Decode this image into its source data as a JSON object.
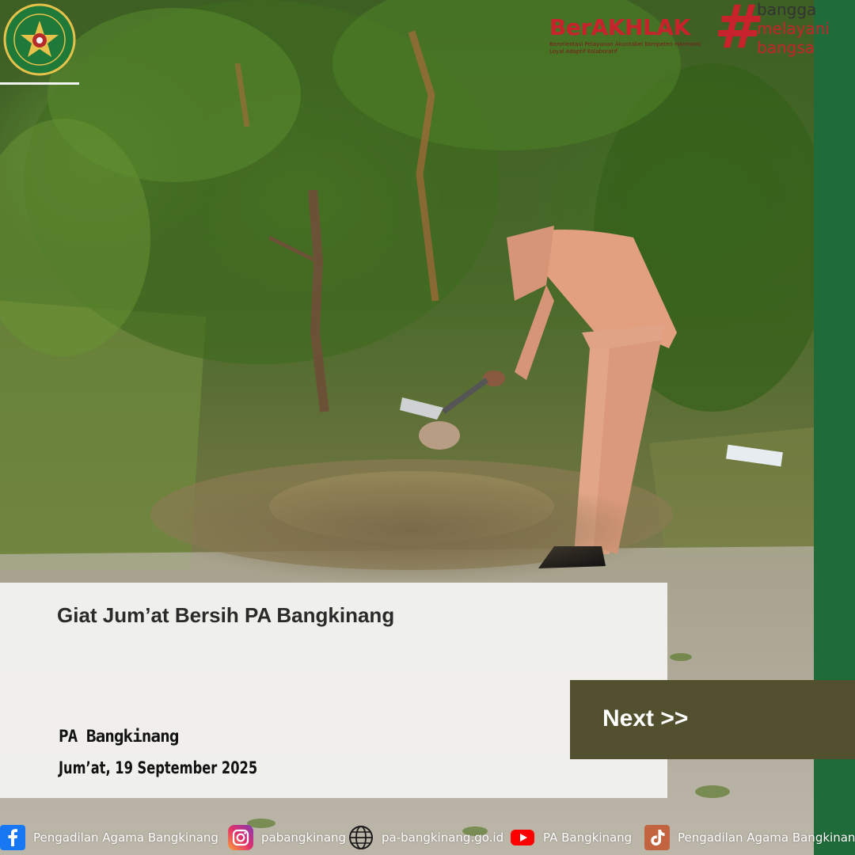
{
  "branding": {
    "berakhlak": "BerAKHLAK",
    "berakhlak_tagline": "Berorientasi Pelayanan Akuntabel Kompeten Harmonis Loyal Adaptif Kolaboratif",
    "hashtag_words": [
      "bangga",
      "melayani",
      "bangsa"
    ],
    "accent_color": "#c8232c",
    "sidebar_color": "#1f6b3a"
  },
  "post": {
    "title": "Giat Jum’at Bersih PA Bangkinang",
    "organization": "PA Bangkinang",
    "date": "Jum’at, 19 September 2025",
    "next_label": "Next >>"
  },
  "footer": {
    "facebook": {
      "icon": "facebook-icon",
      "label": "Pengadilan Agama Bangkinang"
    },
    "instagram": {
      "icon": "instagram-icon",
      "label": "pabangkinang"
    },
    "website": {
      "icon": "globe-icon",
      "label": "pa-bangkinang.go.id"
    },
    "youtube": {
      "icon": "youtube-icon",
      "label": "PA Bangkinang"
    },
    "tiktok": {
      "icon": "tiktok-icon",
      "label": "Pengadilan Agama Bangkinang"
    }
  }
}
